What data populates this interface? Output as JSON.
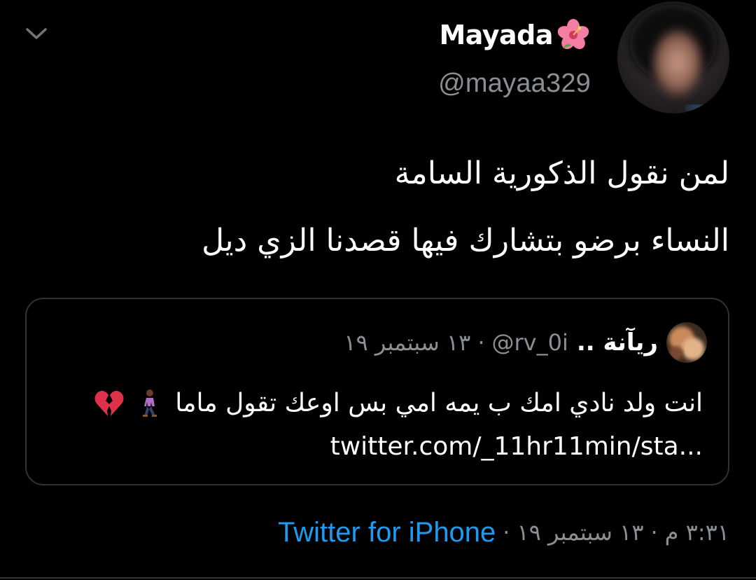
{
  "theme": {
    "background": "#000000",
    "text_primary": "#ffffff",
    "text_secondary": "#8a8f94",
    "accent": "#1d9bf0",
    "border": "#2f3336"
  },
  "author": {
    "display_name": "Mayada",
    "name_emoji": "flower-icon",
    "handle": "@mayaa329",
    "avatar_icon": "avatar"
  },
  "tweet": {
    "lines": [
      "لمن نقول الذكورية السامة",
      "النساء برضو بتشارك فيها قصدنا الزي ديل"
    ]
  },
  "quoted_tweet": {
    "name": "ريآنة ..",
    "handle": "@rv_0i",
    "separator": "·",
    "date": "١٣ سبتمبر ١٩",
    "text": "انت ولد نادي امك ب يمه امي بس اوعك تقول ماما",
    "emojis": [
      "walking-person-icon",
      "broken-heart-icon"
    ],
    "link": "twitter.com/_11hr11min/sta..."
  },
  "footer": {
    "time": "٣:٣١ م",
    "separator": "·",
    "date": "١٣ سبتمبر ١٩",
    "source": "Twitter for iPhone"
  }
}
